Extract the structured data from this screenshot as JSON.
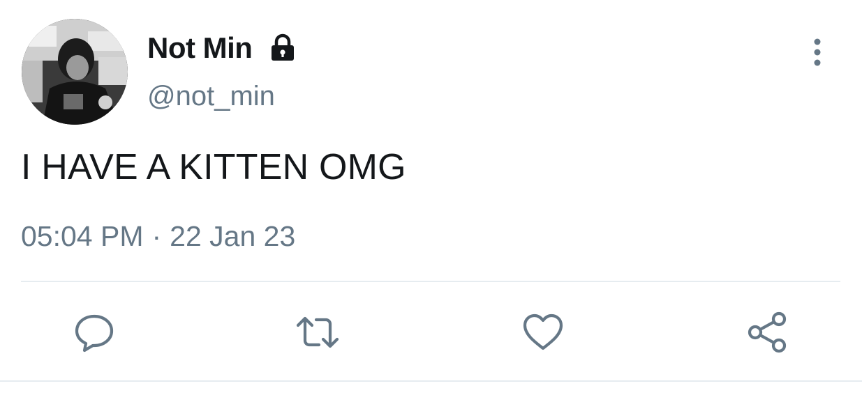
{
  "tweet": {
    "author": {
      "display_name": "Not Min",
      "handle": "@not_min",
      "protected": true
    },
    "text": "I HAVE A KITTEN OMG",
    "time": "05:04 PM",
    "separator": "·",
    "date": "22 Jan 23"
  },
  "icons": {
    "lock": "lock-icon",
    "more": "more-vertical-icon",
    "reply": "reply-icon",
    "retweet": "retweet-icon",
    "like": "heart-icon",
    "share": "share-icon"
  },
  "colors": {
    "text_primary": "#14171a",
    "text_secondary": "#657786",
    "icon_gray": "#657786",
    "divider": "#e6ecf0"
  }
}
